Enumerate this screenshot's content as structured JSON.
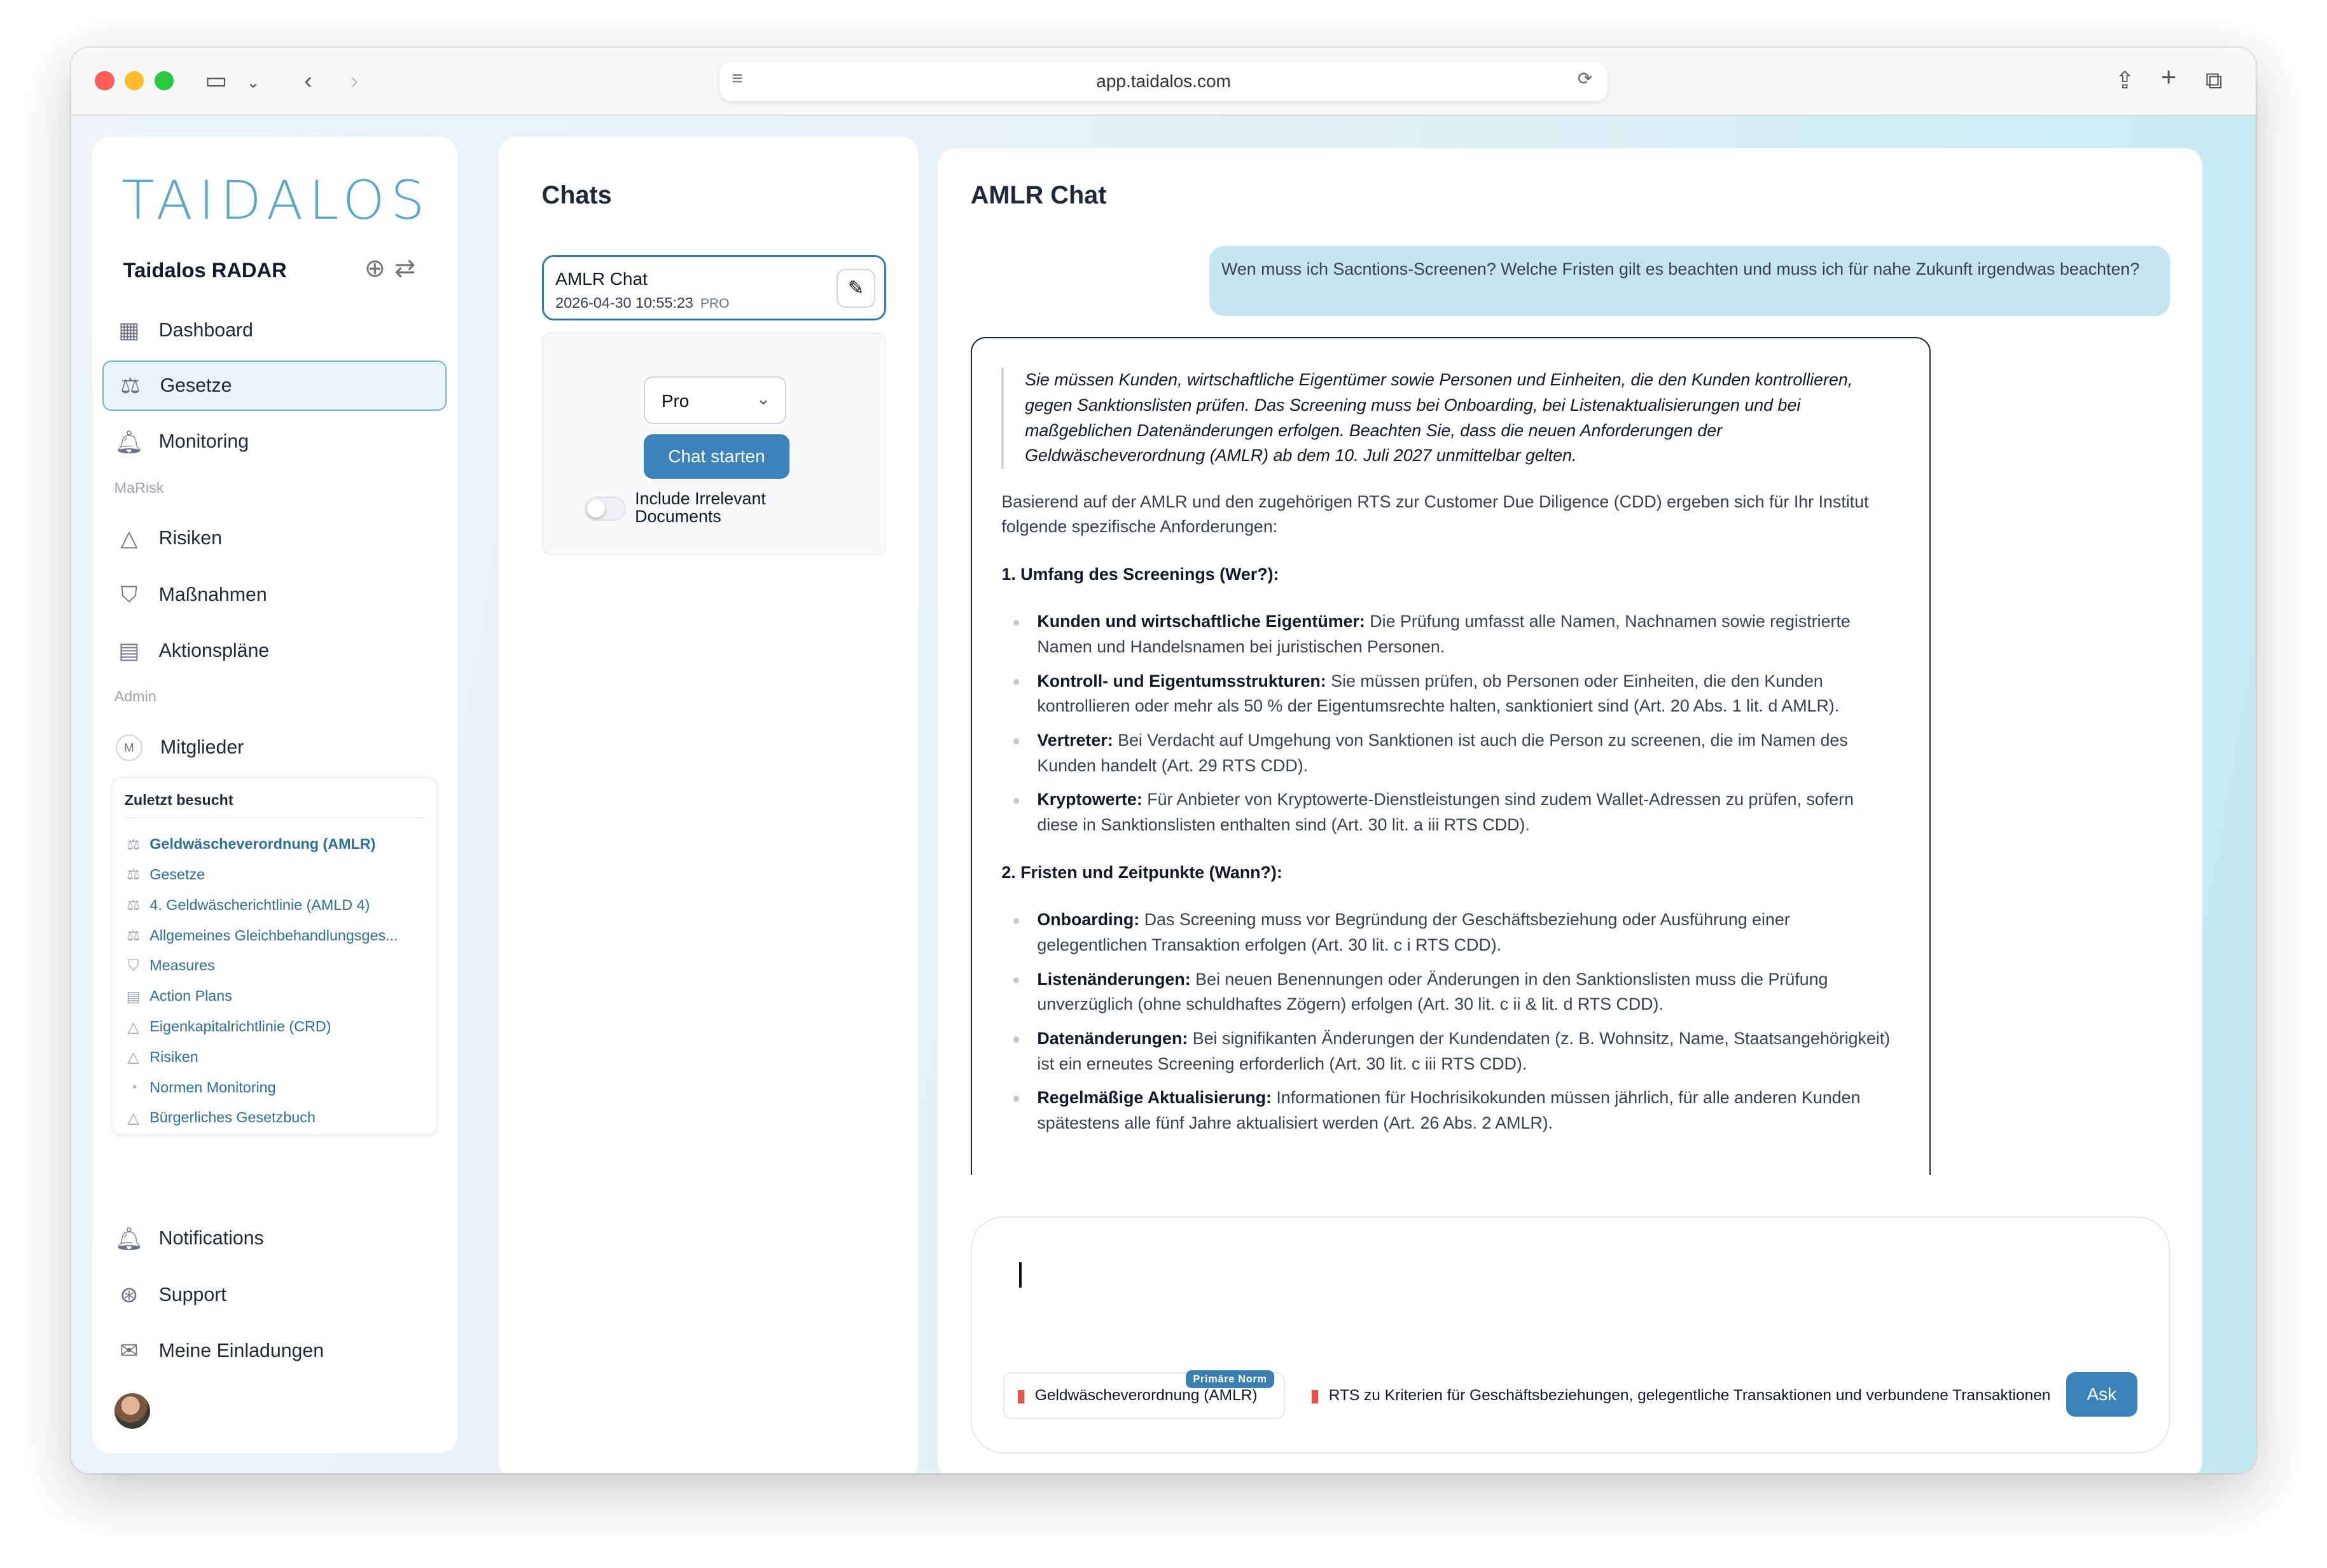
{
  "browser": {
    "url": "app.taidalos.com"
  },
  "sidebar": {
    "logo_text": "TAIDALOS",
    "app_title": "Taidalos RADAR",
    "items": [
      {
        "label": "Dashboard",
        "icon": "grid-icon"
      },
      {
        "label": "Gesetze",
        "icon": "scales-icon",
        "active": true
      },
      {
        "label": "Monitoring",
        "icon": "bell-icon"
      }
    ],
    "section_marisk": "MaRisk",
    "marisk_items": [
      {
        "label": "Risiken",
        "icon": "warning-icon"
      },
      {
        "label": "Maßnahmen",
        "icon": "shield-icon"
      },
      {
        "label": "Aktionspläne",
        "icon": "clipboard-icon"
      }
    ],
    "section_admin": "Admin",
    "admin_items": [
      {
        "label": "Mitglieder",
        "avatar": "M"
      }
    ],
    "recent": {
      "title": "Zuletzt besucht",
      "items": [
        {
          "label": "Geldwäscheverordnung (AMLR)",
          "icon": "⚖"
        },
        {
          "label": "Gesetze",
          "icon": "⚖"
        },
        {
          "label": "4. Geldwäscherichtlinie (AMLD 4)",
          "icon": "⚖"
        },
        {
          "label": "Allgemeines Gleichbehandlungsges...",
          "icon": "⚖"
        },
        {
          "label": "Measures",
          "icon": "⛉"
        },
        {
          "label": "Action Plans",
          "icon": "▤"
        },
        {
          "label": "Eigenkapitalrichtlinie (CRD)",
          "icon": "△"
        },
        {
          "label": "Risiken",
          "icon": "△"
        },
        {
          "label": "Normen Monitoring",
          "icon": "◔"
        },
        {
          "label": "Bürgerliches Gesetzbuch",
          "icon": "△"
        }
      ]
    },
    "bottom_items": [
      {
        "label": "Notifications",
        "icon": "bell-icon"
      },
      {
        "label": "Support",
        "icon": "lifebuoy-icon"
      },
      {
        "label": "Meine Einladungen",
        "icon": "mail-icon"
      }
    ]
  },
  "chats": {
    "title": "Chats",
    "items": [
      {
        "title": "AMLR Chat",
        "date": "2026-04-30 10:55:23",
        "tag": "PRO"
      }
    ],
    "model_select": "Pro",
    "start_label": "Chat starten",
    "toggle_label": "Include Irrelevant Documents"
  },
  "main": {
    "title": "AMLR Chat",
    "user_message": "Wen muss ich Sacntions-Screenen? Welche Fristen gilt es beachten und muss ich für nahe Zukunft irgendwas beachten?",
    "answer": {
      "summary": "Sie müssen Kunden, wirtschaftliche Eigentümer sowie Personen und Einheiten, die den Kunden kontrollieren, gegen Sanktionslisten prüfen. Das Screening muss bei Onboarding, bei Listenaktualisierungen und bei maßgeblichen Datenänderungen erfolgen. Beachten Sie, dass die neuen Anforderungen der Geldwäscheverordnung (AMLR) ab dem 10. Juli 2027 unmittelbar gelten.",
      "intro": "Basierend auf der AMLR und den zugehörigen RTS zur Customer Due Diligence (CDD) ergeben sich für Ihr Institut folgende spezifische Anforderungen:",
      "section1": "1. Umfang des Screenings (Wer?):",
      "list1": [
        {
          "term": "Kunden und wirtschaftliche Eigentümer:",
          "text": " Die Prüfung umfasst alle Namen, Nachnamen sowie registrierte Namen und Handelsnamen bei juristischen Personen."
        },
        {
          "term": "Kontroll- und Eigentumsstrukturen:",
          "text": " Sie müssen prüfen, ob Personen oder Einheiten, die den Kunden kontrollieren oder mehr als 50 % der Eigentumsrechte halten, sanktioniert sind (Art. 20 Abs. 1 lit. d AMLR)."
        },
        {
          "term": "Vertreter:",
          "text": " Bei Verdacht auf Umgehung von Sanktionen ist auch die Person zu screenen, die im Namen des Kunden handelt (Art. 29 RTS CDD)."
        },
        {
          "term": "Kryptowerte:",
          "text": " Für Anbieter von Kryptowerte-Dienstleistungen sind zudem Wallet-Adressen zu prüfen, sofern diese in Sanktionslisten enthalten sind (Art. 30 lit. a iii RTS CDD)."
        }
      ],
      "section2": "2. Fristen und Zeitpunkte (Wann?):",
      "list2": [
        {
          "term": "Onboarding:",
          "text": " Das Screening muss vor Begründung der Geschäftsbeziehung oder Ausführung einer gelegentlichen Transaktion erfolgen (Art. 30 lit. c i RTS CDD)."
        },
        {
          "term": "Listenänderungen:",
          "text": " Bei neuen Benennungen oder Änderungen in den Sanktionslisten muss die Prüfung unverzüglich (ohne schuldhaftes Zögern) erfolgen (Art. 30 lit. c ii & lit. d RTS CDD)."
        },
        {
          "term": "Datenänderungen:",
          "text": " Bei signifikanten Änderungen der Kundendaten (z. B. Wohnsitz, Name, Staatsangehörigkeit) ist ein erneutes Screening erforderlich (Art. 30 lit. c iii RTS CDD)."
        },
        {
          "term": "Regelmäßige Aktualisierung:",
          "text": " Informationen für Hochrisikokunden müssen jährlich, für alle anderen Kunden spätestens alle fünf Jahre aktualisiert werden (Art. 26 Abs. 2 AMLR)."
        }
      ]
    },
    "composer": {
      "docs": [
        {
          "label": "Geldwäscheverordnung (AMLR)",
          "badge": "Primäre Norm"
        },
        {
          "label": "RTS zu Kriterien für Geschäftsbeziehungen, gelegentliche Transaktionen und verbundene Transaktionen"
        }
      ],
      "ask_label": "Ask"
    }
  },
  "colors": {
    "accent": "#3b82b8",
    "user_bubble": "#c7e3f3",
    "brand": "#5aa7c9"
  }
}
